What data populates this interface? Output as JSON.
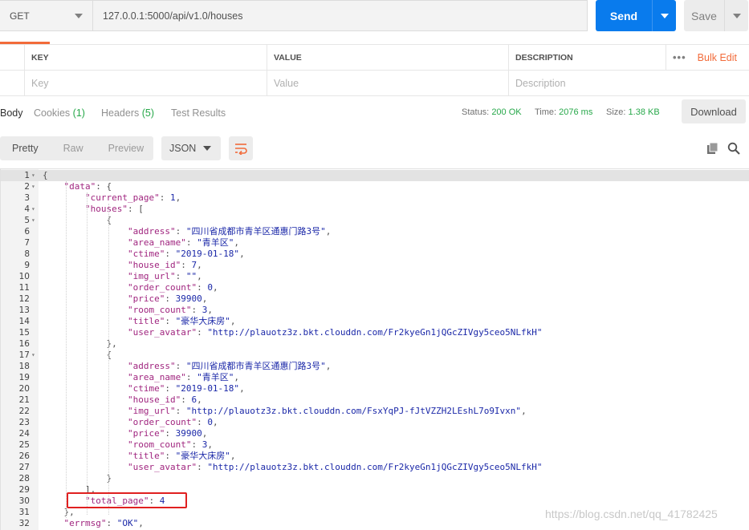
{
  "request": {
    "method": "GET",
    "url": "127.0.0.1:5000/api/v1.0/houses",
    "send_label": "Send",
    "save_label": "Save"
  },
  "params": {
    "headers": [
      "KEY",
      "VALUE",
      "DESCRIPTION"
    ],
    "placeholders": [
      "Key",
      "Value",
      "Description"
    ],
    "more_label": "•••",
    "bulk_edit_label": "Bulk Edit"
  },
  "response_tabs": [
    {
      "label": "Body",
      "count": ""
    },
    {
      "label": "Cookies",
      "count": "(1)"
    },
    {
      "label": "Headers",
      "count": "(5)"
    },
    {
      "label": "Test Results",
      "count": ""
    }
  ],
  "status": {
    "status_label": "Status:",
    "status_value": "200 OK",
    "time_label": "Time:",
    "time_value": "2076 ms",
    "size_label": "Size:",
    "size_value": "1.38 KB"
  },
  "download_label": "Download",
  "toolbar": {
    "formats": [
      "Pretty",
      "Raw",
      "Preview"
    ],
    "language": "JSON",
    "icons": [
      "wrap-lines-icon",
      "copy-icon",
      "search-icon"
    ]
  },
  "colors": {
    "accent": "#f26b3a",
    "send": "#097bed",
    "status_ok": "#27a84a",
    "highlight_box": "#e02020"
  },
  "code_lines": [
    {
      "n": "1",
      "fold": true,
      "t": "{"
    },
    {
      "n": "2",
      "fold": true,
      "t": "    \"data\": {"
    },
    {
      "n": "3",
      "fold": false,
      "t": "        \"current_page\": 1,"
    },
    {
      "n": "4",
      "fold": true,
      "t": "        \"houses\": ["
    },
    {
      "n": "5",
      "fold": true,
      "t": "            {"
    },
    {
      "n": "6",
      "fold": false,
      "t": "                \"address\": \"四川省成都市青羊区通惠门路3号\","
    },
    {
      "n": "7",
      "fold": false,
      "t": "                \"area_name\": \"青羊区\","
    },
    {
      "n": "8",
      "fold": false,
      "t": "                \"ctime\": \"2019-01-18\","
    },
    {
      "n": "9",
      "fold": false,
      "t": "                \"house_id\": 7,"
    },
    {
      "n": "10",
      "fold": false,
      "t": "                \"img_url\": \"\","
    },
    {
      "n": "11",
      "fold": false,
      "t": "                \"order_count\": 0,"
    },
    {
      "n": "12",
      "fold": false,
      "t": "                \"price\": 39900,"
    },
    {
      "n": "13",
      "fold": false,
      "t": "                \"room_count\": 3,"
    },
    {
      "n": "14",
      "fold": false,
      "t": "                \"title\": \"豪华大床房\","
    },
    {
      "n": "15",
      "fold": false,
      "t": "                \"user_avatar\": \"http://plauotz3z.bkt.clouddn.com/Fr2kyeGn1jQGcZIVgy5ceo5NLfkH\""
    },
    {
      "n": "16",
      "fold": false,
      "t": "            },"
    },
    {
      "n": "17",
      "fold": true,
      "t": "            {"
    },
    {
      "n": "18",
      "fold": false,
      "t": "                \"address\": \"四川省成都市青羊区通惠门路3号\","
    },
    {
      "n": "19",
      "fold": false,
      "t": "                \"area_name\": \"青羊区\","
    },
    {
      "n": "20",
      "fold": false,
      "t": "                \"ctime\": \"2019-01-18\","
    },
    {
      "n": "21",
      "fold": false,
      "t": "                \"house_id\": 6,"
    },
    {
      "n": "22",
      "fold": false,
      "t": "                \"img_url\": \"http://plauotz3z.bkt.clouddn.com/FsxYqPJ-fJtVZZH2LEshL7o9Ivxn\","
    },
    {
      "n": "23",
      "fold": false,
      "t": "                \"order_count\": 0,"
    },
    {
      "n": "24",
      "fold": false,
      "t": "                \"price\": 39900,"
    },
    {
      "n": "25",
      "fold": false,
      "t": "                \"room_count\": 3,"
    },
    {
      "n": "26",
      "fold": false,
      "t": "                \"title\": \"豪华大床房\","
    },
    {
      "n": "27",
      "fold": false,
      "t": "                \"user_avatar\": \"http://plauotz3z.bkt.clouddn.com/Fr2kyeGn1jQGcZIVgy5ceo5NLfkH\""
    },
    {
      "n": "28",
      "fold": false,
      "t": "            }"
    },
    {
      "n": "29",
      "fold": false,
      "t": "        ],"
    },
    {
      "n": "30",
      "fold": false,
      "t": "        \"total_page\": 4"
    },
    {
      "n": "31",
      "fold": false,
      "t": "    },"
    },
    {
      "n": "32",
      "fold": false,
      "t": "    \"errmsg\": \"OK\","
    }
  ],
  "watermark": "https://blog.csdn.net/qq_41782425"
}
